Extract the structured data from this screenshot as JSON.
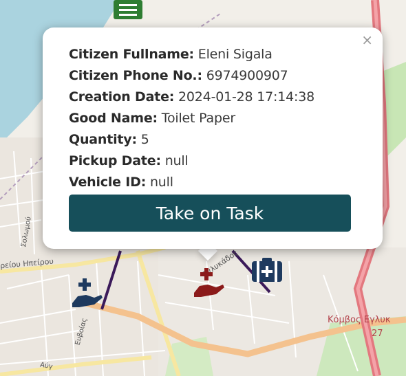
{
  "popup": {
    "close_glyph": "×",
    "fields": [
      {
        "label": "Citizen Fullname:",
        "value": "Eleni Sigala"
      },
      {
        "label": "Citizen Phone No.:",
        "value": "6974900907"
      },
      {
        "label": "Creation Date:",
        "value": "2024-01-28 17:14:38"
      },
      {
        "label": "Good Name:",
        "value": "Toilet Paper"
      },
      {
        "label": "Quantity:",
        "value": "5"
      },
      {
        "label": "Pickup Date:",
        "value": "null"
      },
      {
        "label": "Vehicle ID:",
        "value": "null"
      }
    ],
    "button_label": "Take on Task"
  },
  "map": {
    "labels": {
      "kombos": "Κόμβος Εγλυκ",
      "kombos_num": "27",
      "ipeirou": "ρείου Ηπείρου",
      "eglykadou": "Εγλυκάδος",
      "solomou": "Σολωμού",
      "euvoias": "Ευβοίας",
      "aug": "Αύγ"
    }
  },
  "markers": {
    "top_marker_icon": "list-icon",
    "offer_marker_icon": "hand-plus-icon",
    "request_marker_icon": "hand-heart-plus-icon",
    "vehicle_marker_icon": "first-aid-kit-icon"
  },
  "colors": {
    "button_bg": "#164f5a",
    "offer_marker": "#1e3a5f",
    "request_marker": "#8b1a1a",
    "vehicle_marker": "#1e3a5f",
    "top_marker": "#2e7d32"
  }
}
